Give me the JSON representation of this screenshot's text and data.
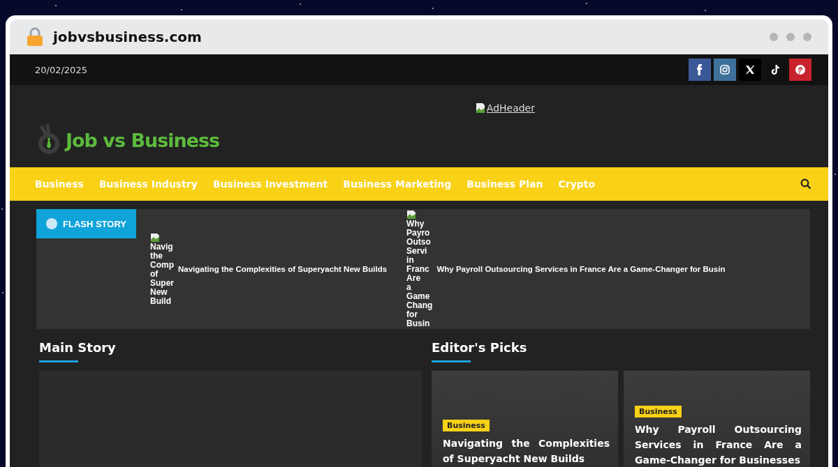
{
  "browser": {
    "address": "jobvsbusiness.com"
  },
  "top_bar": {
    "date": "20/02/2025",
    "social": [
      {
        "kind": "facebook",
        "color": "#3b5998"
      },
      {
        "kind": "instagram",
        "color": "#3f729b"
      },
      {
        "kind": "x",
        "color": "#000000"
      },
      {
        "kind": "tiktok",
        "color": "#111111"
      },
      {
        "kind": "pinterest",
        "color": "#c8232c"
      }
    ]
  },
  "header": {
    "logo_text": "Job vs Business",
    "ad_alt": "AdHeader"
  },
  "nav": {
    "items": [
      "Business",
      "Business Industry",
      "Business Investment",
      "Business Marketing",
      "Business Plan",
      "Crypto"
    ]
  },
  "flash": {
    "label": "FLASH STORY",
    "items": [
      {
        "image_alt": "Navig the Comp of Super New Build",
        "title": "Navigating the Complexities of Superyacht New Builds"
      },
      {
        "image_alt": "Why Payro Outso Servi in Franc Are a Game Chang for Busin",
        "title": "Why Payroll Outsourcing Services in France Are a Game-Changer for Busin"
      }
    ]
  },
  "main_story": {
    "heading": "Main Story"
  },
  "editors_picks": {
    "heading": "Editor's Picks",
    "cards": [
      {
        "tag": "Business",
        "title": "Navigating the Complexities of Superyacht New Builds"
      },
      {
        "tag": "Business",
        "title": "Why Payroll Outsourcing Services in France Are a Game-Changer for Businesses"
      }
    ]
  }
}
